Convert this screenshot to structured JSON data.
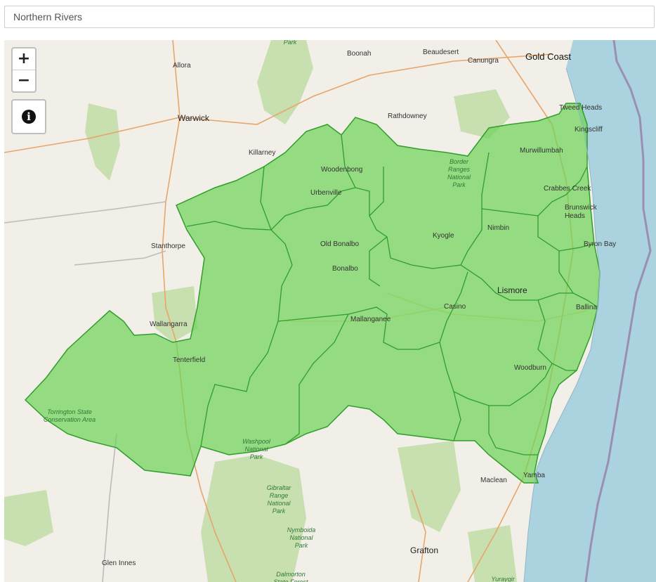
{
  "search": {
    "value": "Northern Rivers"
  },
  "controls": {
    "zoom_in": "+",
    "zoom_out": "−",
    "info": "i"
  },
  "colors": {
    "land": "#f2efe9",
    "sea": "#aad3df",
    "region_fill": "#6fd35a",
    "region_stroke": "#2f9e2a",
    "forest": "#c8dfb0",
    "road": "#e8a56a"
  },
  "labels": {
    "gold_coast": "Gold Coast",
    "boonah": "Boonah",
    "beaudesert": "Beaudesert",
    "canungra": "Canungra",
    "allora": "Allora",
    "warwick": "Warwick",
    "rathdowney": "Rathdowney",
    "tweed_heads": "Tweed Heads",
    "kingscliff": "Kingscliff",
    "killarney": "Killarney",
    "woodenbong": "Woodenbong",
    "murwillumbah": "Murwillumbah",
    "urbenville": "Urbenville",
    "crabbes_creek": "Crabbes Creek",
    "brunswick_heads": "Brunswick Heads",
    "stanthorpe": "Stanthorpe",
    "old_bonalbo": "Old Bonalbo",
    "kyogle": "Kyogle",
    "nimbin": "Nimbin",
    "byron_bay": "Byron Bay",
    "bonalbo": "Bonalbo",
    "lismore": "Lismore",
    "casino": "Casino",
    "ballina": "Ballina",
    "wallangarra": "Wallangarra",
    "mallanganee": "Mallanganee",
    "tenterfield": "Tenterfield",
    "woodburn": "Woodburn",
    "maclean": "Maclean",
    "yamba": "Yamba",
    "grafton": "Grafton",
    "glen_innes": "Glen Innes",
    "border_ranges": "Border Ranges National Park",
    "torrington": "Torrington State Conservation Area",
    "washpool": "Washpool National Park",
    "gibraltar": "Gibraltar Range National Park",
    "nymboida": "Nymboida National Park",
    "dalmorton": "Dalmorton State Forest",
    "park_top": "Park",
    "yuraygir": "Yuraygir"
  }
}
